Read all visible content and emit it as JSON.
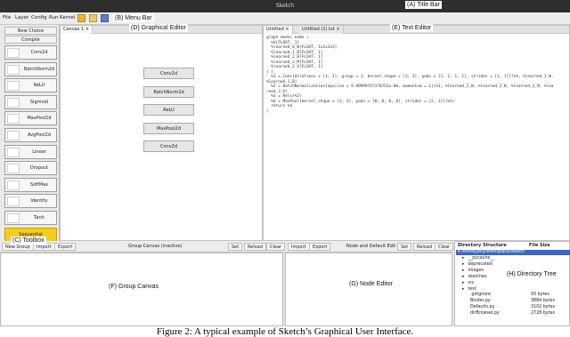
{
  "window": {
    "title": "Sketch"
  },
  "menu": {
    "items": [
      "File",
      "Layer",
      "Config",
      "Run",
      "Kernel"
    ]
  },
  "annotations": {
    "title_bar": "(A) Title Bar",
    "menu_bar": "(B) Menu Bar",
    "toolbox": "(C) Toolbox",
    "graphical_editor": "(D) Graphical Editor",
    "text_editor": "(E) Text Editor",
    "group_canvas": "(F) Group Canvas",
    "node_editor": "(G) Node Editor",
    "directory_tree": "(H) Directory Tree"
  },
  "toolbox": {
    "new_choice": "New Choice",
    "compile": "Compile",
    "tools": [
      {
        "label": "Conv2d",
        "icon": "conv-icon",
        "active": false
      },
      {
        "label": "BatchNorm2d",
        "icon": "batchnorm-icon",
        "active": false
      },
      {
        "label": "ReLU",
        "icon": "relu-icon",
        "active": false
      },
      {
        "label": "Sigmoid",
        "icon": "sigmoid-icon",
        "active": false
      },
      {
        "label": "MaxPool2d",
        "icon": "maxpool-icon",
        "active": false
      },
      {
        "label": "AvgPool2d",
        "icon": "avgpool-icon",
        "active": false
      },
      {
        "label": "Linear",
        "icon": "linear-icon",
        "active": false
      },
      {
        "label": "Dropout",
        "icon": "dropout-icon",
        "active": false
      },
      {
        "label": "SoftMax",
        "icon": "softmax-icon",
        "active": false
      },
      {
        "label": "Identity",
        "icon": "identity-icon",
        "active": false
      },
      {
        "label": "Tanh",
        "icon": "tanh-icon",
        "active": false
      },
      {
        "label": "Sequential",
        "icon": "",
        "active": true
      }
    ]
  },
  "graphical_editor": {
    "tab": "Canvas 1 ×",
    "nodes": [
      "Conv2d",
      "BatchNorm2d",
      "ReLU",
      "MaxPool2d",
      "Conv2d"
    ],
    "arrow_color": "#2e8b2e"
  },
  "text_editor": {
    "tabs": [
      "Untitled ×",
      "Untitled (1).txt ×"
    ],
    "lines": [
      "graph model_name (",
      "  %X[FLOAT, 1]",
      "  %learned_0_W[FLOAT, 1x1x3x3]",
      "  %learned_1_B[FLOAT, 1]",
      "  %learned_2_B[FLOAT, 1]",
      "  %learned_2_M[FLOAT, 1]",
      "  %learned_2_V[FLOAT, 1]",
      ") {",
      "  %1 = Conv[dilations = [1, 1], group = 1, kernel_shape = [3, 3], pads = [1, 1, 1, 1], strides = [1, 1]](%X, %learned_1_W,",
      "%learned_1_B)",
      "  %2 = BatchNormalization[epsilon = 9.99999747378752e-06, momentum = 1](%1, %learned_2_W, %learned_2_B, %learned_2_M, %lea",
      "rned_2_V)",
      "  %3 = Relu(%2)",
      "  %4 = MaxPool[kernel_shape = [3, 3], pads = [0, 0, 0, 0], strides = [2, 2]](%3)",
      "  return %4",
      "}"
    ]
  },
  "group_canvas": {
    "buttons_left": [
      "New Group",
      "Import",
      "Export"
    ],
    "title": "Group Canvas (inactive)",
    "buttons_right": [
      "Set",
      "Reload",
      "Clear"
    ]
  },
  "node_editor": {
    "buttons_left": [
      "Import",
      "Export"
    ],
    "title": "Node and Default Edit",
    "buttons_right": [
      "Set",
      "Reload",
      "Clear"
    ]
  },
  "directory_tree": {
    "header_name": "Directory Structure",
    "header_size": "File Size",
    "root": "/home/jelly/workspace/sketch",
    "entries": [
      {
        "name": "__pycache__",
        "size": ""
      },
      {
        "name": "deprecated",
        "size": ""
      },
      {
        "name": "images",
        "size": ""
      },
      {
        "name": "sketches",
        "size": ""
      },
      {
        "name": "src",
        "size": ""
      },
      {
        "name": "test",
        "size": ""
      },
      {
        "name": ".gitignore",
        "size": "93 bytes"
      },
      {
        "name": "Binder.py",
        "size": "3884 bytes"
      },
      {
        "name": "Defaults.py",
        "size": "3102 bytes"
      },
      {
        "name": "dirBrowser.py",
        "size": "2728 bytes"
      }
    ]
  },
  "caption": "Figure 2: A typical example of Sketch’s Graphical User Interface."
}
